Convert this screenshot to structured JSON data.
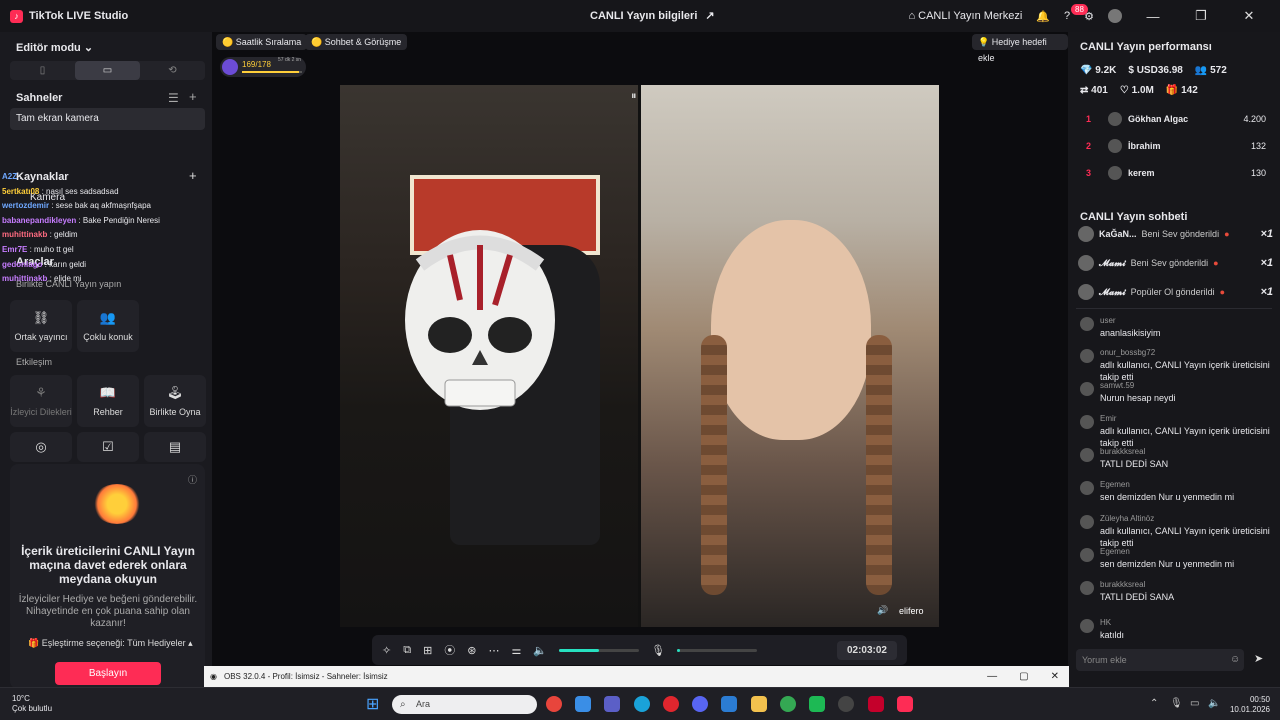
{
  "titlebar": {
    "app_name": "TikTok LIVE Studio",
    "center_title": "CANLI Yayın bilgileri",
    "live_center": "CANLI Yayın Merkezi",
    "notif_count": "88"
  },
  "left": {
    "editor_mode": "Editör modu",
    "scenes_label": "Sahneler",
    "scene_item": "Tam ekran kamera",
    "sources_label": "Kaynaklar",
    "camera_label": "Kamera",
    "tools_label": "Araçlar",
    "together_label": "Birlikte CANLI Yayın yapın",
    "tiles": [
      "Ortak yayıncı",
      "Çoklu konuk"
    ],
    "interaction_label": "Etkileşim",
    "tiles2": [
      "İzleyici Dilekleri",
      "Rehber",
      "Birlikte Oyna"
    ],
    "promo_title": "İçerik üreticilerini CANLI Yayın maçına davet ederek onlara meydana okuyun",
    "promo_text": "İzleyiciler Hediye ve beğeni gönderebilir. Nihayetinde en çok puana sahip olan kazanır!",
    "match_option": "Eşleştirme seçeneği: Tüm Hediyeler",
    "start_button": "Başlayın"
  },
  "overlay_chat": [
    {
      "user": "A2Z",
      "text": ""
    },
    {
      "user": "5ertkatı08",
      "text": "nasıl ses sadsadsad"
    },
    {
      "user": "wertozdemir",
      "text": "sese bak aq akfmaşnfşapa"
    },
    {
      "user": "babanepandikleyen",
      "text": "Bake Pendiğin Neresi"
    },
    {
      "user": "muhittinakb",
      "text": "geldim"
    },
    {
      "user": "Emr7E",
      "text": "muho tt gel"
    },
    {
      "user": "gedonlago",
      "text": "karın geldi"
    },
    {
      "user": "muhittinakb",
      "text": "elide mi"
    }
  ],
  "center": {
    "chip_hourly": "Saatlik Sıralama",
    "chip_chat": "Sohbet & Görüşme",
    "chip_gift_goal": "Hediye hedefi ekle",
    "level_value": "169/178",
    "level_time": "57 dk 2 sn",
    "guest_name": "elifero",
    "timer": "02:03:02",
    "audio_level": 0.5,
    "mic_level": 0.04
  },
  "right": {
    "perf_title": "CANLI Yayın performansı",
    "stats1": [
      "9.2K",
      "USD36.98",
      "572"
    ],
    "stats2": [
      "401",
      "1.0M",
      "142"
    ],
    "ranking": [
      {
        "n": "1",
        "name": "Gökhan Algac",
        "score": "4.200"
      },
      {
        "n": "2",
        "name": "İbrahim",
        "score": "132"
      },
      {
        "n": "3",
        "name": "kerem",
        "score": "130"
      }
    ],
    "chat_title": "CANLI Yayın sohbeti",
    "gifts": [
      {
        "name": "KaĞaN...",
        "text": "Beni Sev gönderildi",
        "count": "×1"
      },
      {
        "name": "𝓜𝓪𝓶𝓲",
        "text": "Beni Sev gönderildi",
        "count": "×1"
      },
      {
        "name": "𝓜𝓪𝓶𝓲",
        "text": "Popüler Ol gönderildi",
        "count": "×1"
      }
    ],
    "comments": [
      {
        "name": "user",
        "text": "ananlasikisiyim"
      },
      {
        "name": "onur_bossbg72",
        "text": "adlı kullanıcı, CANLI Yayın içerik üreticisini takip etti"
      },
      {
        "name": "samwt.59",
        "text": "Nurun hesap neydi"
      },
      {
        "name": "Emir",
        "text": "adlı kullanıcı, CANLI Yayın içerik üreticisini takip etti"
      },
      {
        "name": "burakkksreal",
        "text": "TATLI DEDİ SAN"
      },
      {
        "name": "Egemen",
        "text": "sen demizden Nur u yenmedin mi"
      },
      {
        "name": "Züleyha Altinöz",
        "text": "adlı kullanıcı, CANLI Yayın içerik üreticisini takip etti"
      },
      {
        "name": "Egemen",
        "text": "sen demizden Nur u yenmedin mi"
      },
      {
        "name": "burakkksreal",
        "text": "TATLI DEDİ SANA"
      },
      {
        "name": "HK",
        "text": "katıldı"
      }
    ],
    "comment_placeholder": "Yorum ekle"
  },
  "obs": {
    "title": "OBS 32.0.4 - Profil: İsimsiz - Sahneler: İsimsiz"
  },
  "taskbar": {
    "temp": "10°C",
    "weather": "Çok bulutlu",
    "search": "Ara",
    "time": "00:50",
    "date": "10.01.2026"
  },
  "colors": {
    "accent": "#fe2c55",
    "teal": "#27e0c0"
  }
}
